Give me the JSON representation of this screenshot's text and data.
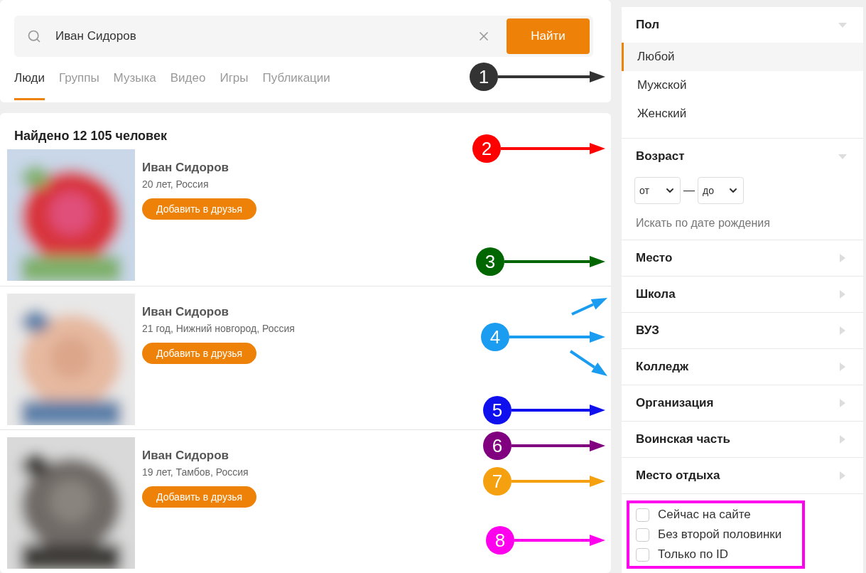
{
  "search": {
    "value": "Иван Сидоров",
    "button": "Найти"
  },
  "tabs": [
    {
      "label": "Люди",
      "selected": true
    },
    {
      "label": "Группы",
      "selected": false
    },
    {
      "label": "Музыка",
      "selected": false
    },
    {
      "label": "Видео",
      "selected": false
    },
    {
      "label": "Игры",
      "selected": false
    },
    {
      "label": "Публикации",
      "selected": false
    }
  ],
  "results": {
    "heading": "Найдено 12 105 человек",
    "people": [
      {
        "name": "Иван Сидоров",
        "details": "20 лет, Россия",
        "button": "Добавить в друзья"
      },
      {
        "name": "Иван Сидоров",
        "details": "21 год, Нижний новгород, Россия",
        "button": "Добавить в друзья"
      },
      {
        "name": "Иван Сидоров",
        "details": "19 лет, Тамбов, Россия",
        "button": "Добавить в друзья"
      }
    ]
  },
  "filters": [
    {
      "kind": "options",
      "title": "Пол",
      "expanded": true,
      "options": [
        {
          "label": "Любой",
          "selected": true
        },
        {
          "label": "Мужской",
          "selected": false
        },
        {
          "label": "Женский",
          "selected": false
        }
      ]
    },
    {
      "kind": "age",
      "title": "Возраст",
      "expanded": true,
      "from": "от",
      "separator": "—",
      "to": "до",
      "link": "Искать по дате рождения"
    },
    {
      "kind": "row",
      "title": "Место",
      "expanded": false
    },
    {
      "kind": "row",
      "title": "Школа",
      "expanded": false
    },
    {
      "kind": "row",
      "title": "ВУЗ",
      "expanded": false
    },
    {
      "kind": "row",
      "title": "Колледж",
      "expanded": false
    },
    {
      "kind": "row",
      "title": "Организация",
      "expanded": false
    },
    {
      "kind": "row",
      "title": "Воинская часть",
      "expanded": false
    },
    {
      "kind": "row",
      "title": "Место отдыха",
      "expanded": false
    }
  ],
  "checkboxes": [
    {
      "label": "Сейчас на сайте",
      "checked": false
    },
    {
      "label": "Без второй половинки",
      "checked": false
    },
    {
      "label": "Только по ID",
      "checked": false
    }
  ],
  "annotations": [
    {
      "label": "1",
      "color": "#333333",
      "kind": "single"
    },
    {
      "label": "2",
      "color": "#ff0000",
      "kind": "single"
    },
    {
      "label": "3",
      "color": "#006600",
      "kind": "single"
    },
    {
      "label": "4",
      "color": "#1a9cf0",
      "kind": "fan"
    },
    {
      "label": "5",
      "color": "#1010ee",
      "kind": "single"
    },
    {
      "label": "6",
      "color": "#800080",
      "kind": "single"
    },
    {
      "label": "7",
      "color": "#f5a00f",
      "kind": "single"
    },
    {
      "label": "8",
      "color": "#ff00ee",
      "kind": "single"
    }
  ]
}
